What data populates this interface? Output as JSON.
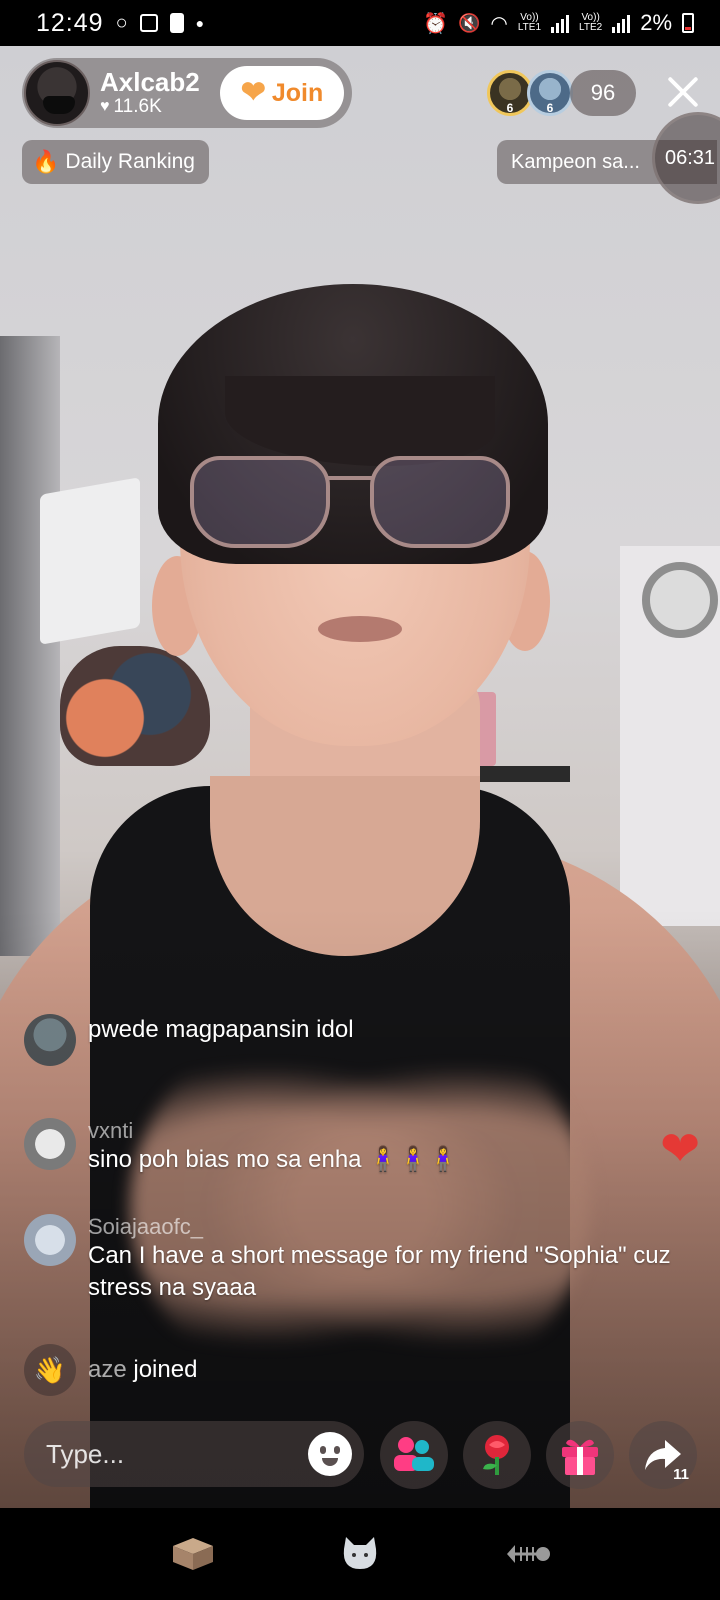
{
  "status_bar": {
    "time": "12:49",
    "sim1_label": "Vo))\nLTE1",
    "sim2_label": "Vo))\nLTE2",
    "battery": "2%"
  },
  "host": {
    "name": "Axlcab2",
    "likes": "11.6K",
    "join_label": "Join"
  },
  "viewers": {
    "badge_1": "6",
    "badge_2": "6",
    "count": "96"
  },
  "ranking": {
    "label": "Daily Ranking"
  },
  "event": {
    "label": "Kampeon sa...",
    "timer": "06:31"
  },
  "comments": [
    {
      "user": "",
      "text": "pwede magpapansin idol"
    },
    {
      "user": "vxnti",
      "text": "sino poh bias mo sa enha 🧍‍♀️🧍‍♀️🧍‍♀️"
    },
    {
      "user": "Soiajaaofc_",
      "text": "Can I have a short message for my friend \"Sophia\" cuz stress na syaaa"
    }
  ],
  "join_notice": {
    "user": "aze",
    "text": "joined"
  },
  "input": {
    "placeholder": "Type..."
  },
  "actions": {
    "share_count": "11"
  },
  "colors": {
    "join_text": "#f08a2c",
    "heart": "#e53935",
    "gift": "#f0357a",
    "people_icon_a": "#ff3d84",
    "people_icon_b": "#1fb7c9"
  },
  "icons": [
    "search-icon"
  ]
}
